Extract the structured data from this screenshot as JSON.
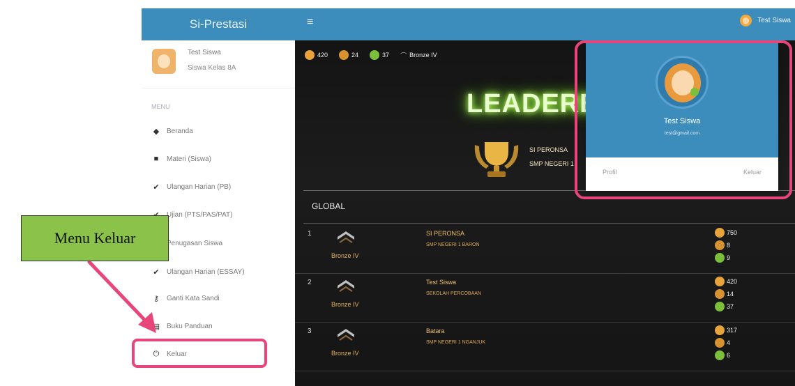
{
  "app": {
    "brand": "Si-Prestasi",
    "hamburger": "≡",
    "top_user": "Test Siswa"
  },
  "sidebar": {
    "user_name": "Test Siswa",
    "user_role": "Siswa Kelas 8A",
    "header": "MENU",
    "items": [
      {
        "icon": "dashboard-icon",
        "glyph": "◆",
        "label": "Beranda"
      },
      {
        "icon": "folder-icon",
        "glyph": "■",
        "label": "Materi (Siswa)"
      },
      {
        "icon": "check-icon",
        "glyph": "✔",
        "label": "Ulangan Harian (PB)"
      },
      {
        "icon": "check-icon",
        "glyph": "✔",
        "label": "Ujian (PTS/PAS/PAT)"
      },
      {
        "icon": "check-icon",
        "glyph": "✔",
        "label": "Penugasan Siswa"
      },
      {
        "icon": "check-icon",
        "glyph": "✔",
        "label": "Ulangan Harian (ESSAY)"
      },
      {
        "icon": "key-icon",
        "glyph": "⚷",
        "label": "Ganti Kata Sandi"
      },
      {
        "icon": "book-icon",
        "glyph": "▤",
        "label": "Buku Panduan"
      },
      {
        "icon": "power-icon",
        "glyph": "⏻",
        "label": "Keluar"
      }
    ]
  },
  "stats": {
    "coins": "420",
    "medals": "24",
    "gems": "37",
    "rank": "Bronze IV"
  },
  "leaderboard": {
    "title": "LEADERBO",
    "school_name": "SI PERONSA",
    "school_sub": "SMP NEGERI 1",
    "global_label": "GLOBAL",
    "rows": [
      {
        "rank": "1",
        "rank_label": "Bronze IV",
        "name": "SI PERONSA",
        "school": "SMP NEGERI 1 BARON",
        "coins": "750",
        "medals": "8",
        "gems": "9"
      },
      {
        "rank": "2",
        "rank_label": "Bronze IV",
        "name": "Test Siswa",
        "school": "SEKOLAH PERCOBAAN",
        "coins": "420",
        "medals": "14",
        "gems": "37"
      },
      {
        "rank": "3",
        "rank_label": "Bronze IV",
        "name": "Batara",
        "school": "SMP NEGERI 1 NGANJUK",
        "coins": "317",
        "medals": "4",
        "gems": "6"
      }
    ]
  },
  "dropdown": {
    "name": "Test Siswa",
    "email": "test@gmail.com",
    "profile_label": "Profil",
    "logout_label": "Keluar"
  },
  "annotation": {
    "label": "Menu Keluar"
  },
  "colors": {
    "header": "#3c8dbc",
    "highlight": "#e8457a",
    "label_bg": "#8bc34a",
    "gold": "#e8a33a",
    "green": "#7bbf3a"
  }
}
